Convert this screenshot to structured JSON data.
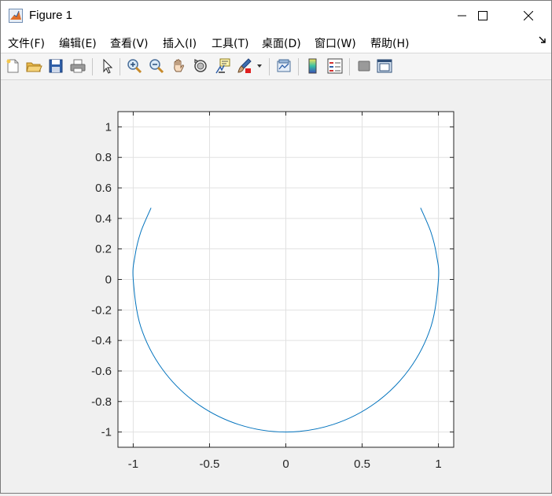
{
  "window": {
    "title": "Figure 1",
    "icon": "matlab-figure-icon"
  },
  "menu": {
    "items": [
      "文件(F)",
      "编辑(E)",
      "查看(V)",
      "插入(I)",
      "工具(T)",
      "桌面(D)",
      "窗口(W)",
      "帮助(H)"
    ]
  },
  "toolbar": {
    "icons": [
      "new-figure-icon",
      "open-file-icon",
      "save-icon",
      "print-icon",
      "pointer-icon",
      "zoom-in-icon",
      "zoom-out-icon",
      "pan-hand-icon",
      "rotate-3d-icon",
      "data-cursor-icon",
      "brush-icon",
      "link-plot-icon",
      "colorbar-icon",
      "legend-icon",
      "hide-plot-tools-icon",
      "show-plot-tools-icon"
    ]
  },
  "chart_data": {
    "type": "line",
    "title": "",
    "xlabel": "",
    "ylabel": "",
    "xlim": [
      -1.1,
      1.1
    ],
    "ylim": [
      -1.1,
      1.1
    ],
    "xticks": [
      -1,
      -0.5,
      0,
      0.5,
      1
    ],
    "xtick_labels": [
      "-1",
      "-0.5",
      "0",
      "0.5",
      "1"
    ],
    "yticks": [
      1,
      0.8,
      0.6,
      0.4,
      0.2,
      0,
      -0.2,
      -0.4,
      -0.6,
      -0.8,
      -1
    ],
    "ytick_labels": [
      "1",
      "0.8",
      "0.6",
      "0.4",
      "0.2",
      "0",
      "-0.2",
      "-0.4",
      "-0.6",
      "-0.8",
      "-1"
    ],
    "grid": true,
    "series": [
      {
        "color": "#0072bd",
        "x": [
          0.883,
          0.951,
          0.988,
          1.0,
          0.951,
          0.809,
          0.588,
          0.309,
          0.0,
          -0.309,
          -0.588,
          -0.809,
          -0.951,
          -1.0,
          -0.988,
          -0.951,
          -0.883
        ],
        "y": [
          0.469,
          0.309,
          0.156,
          0.0,
          -0.309,
          -0.588,
          -0.809,
          -0.951,
          -1.0,
          -0.951,
          -0.809,
          -0.588,
          -0.309,
          0.0,
          0.156,
          0.309,
          0.469
        ]
      }
    ]
  }
}
